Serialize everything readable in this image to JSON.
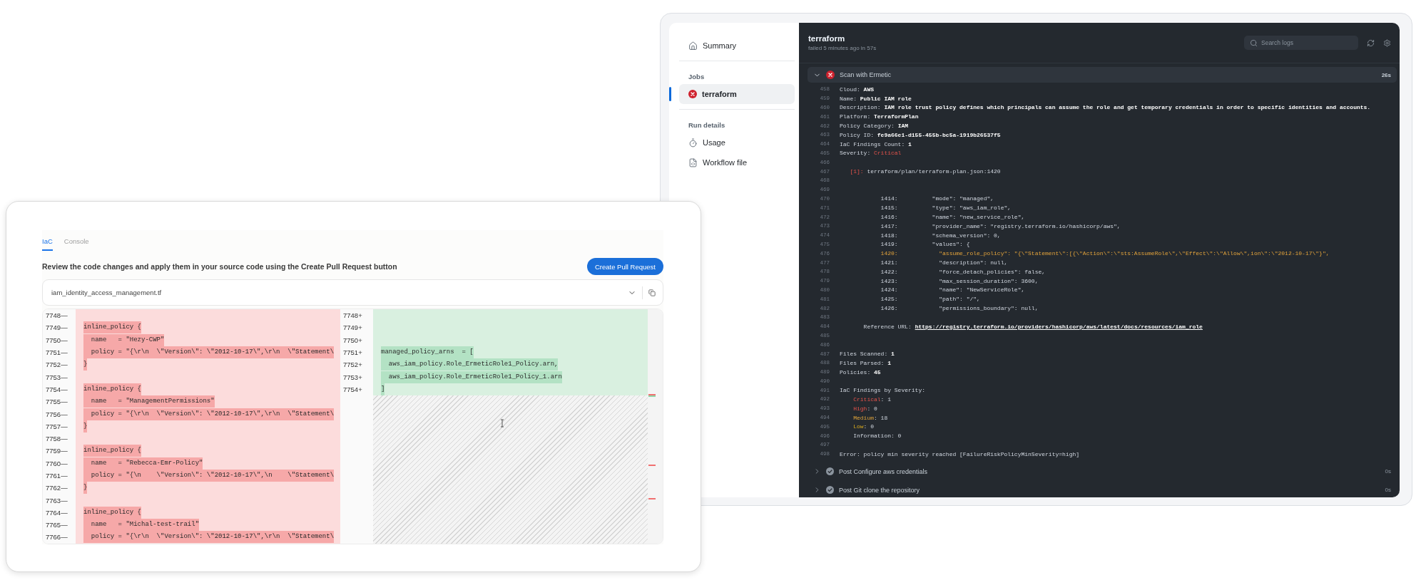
{
  "run_window": {
    "sidebar": {
      "nav": [
        {
          "label": "Summary",
          "kind": "home"
        }
      ],
      "jobs": {
        "heading": "Jobs",
        "items": [
          {
            "label": "terraform",
            "kind": "failed",
            "selected": true
          }
        ]
      },
      "run_details": {
        "heading": "Run details",
        "items": [
          {
            "label": "Usage",
            "kind": "timer"
          },
          {
            "label": "Workflow file",
            "kind": "file"
          }
        ]
      }
    },
    "job": {
      "title": "terraform",
      "subtitle": "failed 5 minutes ago in 57s",
      "search": {
        "placeholder": "Search logs"
      },
      "steps": [
        {
          "name": "Scan with Ermetic",
          "kind": "failed",
          "expanded": true,
          "duration": "26s",
          "log": [
            {
              "num": "458",
              "segments": [
                {
                  "text": "Cloud: ",
                  "kind": "plain"
                },
                {
                  "text": "AWS",
                  "kind": "bold"
                }
              ]
            },
            {
              "num": "459",
              "segments": [
                {
                  "text": "Name: ",
                  "kind": "plain"
                },
                {
                  "text": "Public IAM role",
                  "kind": "bold"
                }
              ]
            },
            {
              "num": "460",
              "segments": [
                {
                  "text": "Description: ",
                  "kind": "plain"
                },
                {
                  "text": "IAM role trust policy defines which principals can assume the role and get temporary credentials in order to specific identities and accounts.",
                  "kind": "bold"
                }
              ]
            },
            {
              "num": "461",
              "segments": [
                {
                  "text": "Platform: ",
                  "kind": "plain"
                },
                {
                  "text": "TerraformPlan",
                  "kind": "bold"
                }
              ]
            },
            {
              "num": "462",
              "segments": [
                {
                  "text": "Policy Category: ",
                  "kind": "plain"
                },
                {
                  "text": "IAM",
                  "kind": "bold"
                }
              ]
            },
            {
              "num": "463",
              "segments": [
                {
                  "text": "Policy ID: ",
                  "kind": "plain"
                },
                {
                  "text": "fe9a66e1-d155-455b-bc5a-1919b26537f5",
                  "kind": "bold"
                }
              ]
            },
            {
              "num": "464",
              "segments": [
                {
                  "text": "IaC Findings Count: ",
                  "kind": "plain"
                },
                {
                  "text": "1",
                  "kind": "bold"
                }
              ]
            },
            {
              "num": "465",
              "segments": [
                {
                  "text": "Severity: ",
                  "kind": "plain"
                },
                {
                  "text": "Critical",
                  "kind": "red"
                }
              ]
            },
            {
              "num": "466"
            },
            {
              "num": "467",
              "segments": [
                {
                  "text": "   [1]:",
                  "kind": "red"
                },
                {
                  "text": " terraform/plan/terraform-plan.json:1420",
                  "kind": "plain"
                }
              ]
            },
            {
              "num": "468"
            },
            {
              "num": "469"
            },
            {
              "num": "470",
              "segments": [
                {
                  "text": "            1414:          \"mode\": \"managed\",",
                  "kind": "plain"
                }
              ]
            },
            {
              "num": "471",
              "segments": [
                {
                  "text": "            1415:          \"type\": \"aws_iam_role\",",
                  "kind": "plain"
                }
              ]
            },
            {
              "num": "472",
              "segments": [
                {
                  "text": "            1416:          \"name\": \"new_service_role\",",
                  "kind": "plain"
                }
              ]
            },
            {
              "num": "473",
              "segments": [
                {
                  "text": "            1417:          \"provider_name\": \"registry.terraform.io/hashicorp/aws\",",
                  "kind": "plain"
                }
              ]
            },
            {
              "num": "474",
              "segments": [
                {
                  "text": "            1418:          \"schema_version\": 0,",
                  "kind": "plain"
                }
              ]
            },
            {
              "num": "475",
              "segments": [
                {
                  "text": "            1419:          \"values\": {",
                  "kind": "plain"
                }
              ]
            },
            {
              "num": "476",
              "segments": [
                {
                  "text": "            1420:            \"assume_role_policy\": \"{\\\"Statement\\\":[{\\\"Action\\\":\\\"sts:AssumeRole\\\",\\\"Effect\\\":\\\"Allow\\\",ion\\\":\\\"2012-10-17\\\"}\",",
                  "kind": "highlight"
                }
              ]
            },
            {
              "num": "477",
              "segments": [
                {
                  "text": "            1421:            \"description\": null,",
                  "kind": "plain"
                }
              ]
            },
            {
              "num": "478",
              "segments": [
                {
                  "text": "            1422:            \"force_detach_policies\": false,",
                  "kind": "plain"
                }
              ]
            },
            {
              "num": "479",
              "segments": [
                {
                  "text": "            1423:            \"max_session_duration\": 3600,",
                  "kind": "plain"
                }
              ]
            },
            {
              "num": "480",
              "segments": [
                {
                  "text": "            1424:            \"name\": \"NewServiceRole\",",
                  "kind": "plain"
                }
              ]
            },
            {
              "num": "481",
              "segments": [
                {
                  "text": "            1425:            \"path\": \"/\",",
                  "kind": "plain"
                }
              ]
            },
            {
              "num": "482",
              "segments": [
                {
                  "text": "            1426:            \"permissions_boundary\": null,",
                  "kind": "plain"
                }
              ]
            },
            {
              "num": "483"
            },
            {
              "num": "484",
              "segments": [
                {
                  "text": "       Reference URL: ",
                  "kind": "plain"
                },
                {
                  "text": "https://registry.terraform.io/providers/hashicorp/aws/latest/docs/resources/iam_role",
                  "kind": "link"
                }
              ]
            },
            {
              "num": "485"
            },
            {
              "num": "486"
            },
            {
              "num": "487",
              "segments": [
                {
                  "text": "Files Scanned: ",
                  "kind": "plain"
                },
                {
                  "text": "1",
                  "kind": "bold"
                }
              ]
            },
            {
              "num": "488",
              "segments": [
                {
                  "text": "Files Parsed: ",
                  "kind": "plain"
                },
                {
                  "text": "1",
                  "kind": "bold"
                }
              ]
            },
            {
              "num": "489",
              "segments": [
                {
                  "text": "Policies: ",
                  "kind": "plain"
                },
                {
                  "text": "45",
                  "kind": "bold"
                }
              ]
            },
            {
              "num": "490"
            },
            {
              "num": "491",
              "segments": [
                {
                  "text": "IaC Findings by Severity:",
                  "kind": "plain"
                }
              ]
            },
            {
              "num": "492",
              "segments": [
                {
                  "text": "    Critical",
                  "kind": "red"
                },
                {
                  "text": ": 1",
                  "kind": "plain"
                }
              ]
            },
            {
              "num": "493",
              "segments": [
                {
                  "text": "    High",
                  "kind": "red"
                },
                {
                  "text": ": 0",
                  "kind": "plain"
                }
              ]
            },
            {
              "num": "494",
              "segments": [
                {
                  "text": "    Medium",
                  "kind": "orange"
                },
                {
                  "text": ": 18",
                  "kind": "plain"
                }
              ]
            },
            {
              "num": "495",
              "segments": [
                {
                  "text": "    Low",
                  "kind": "yellow"
                },
                {
                  "text": ": 0",
                  "kind": "plain"
                }
              ]
            },
            {
              "num": "496",
              "segments": [
                {
                  "text": "    Information: 0",
                  "kind": "plain"
                }
              ]
            },
            {
              "num": "497"
            },
            {
              "num": "498",
              "segments": [
                {
                  "text": "Error: policy min severity reached [FailureRiskPolicyMinSeverity=high]",
                  "kind": "plain"
                }
              ]
            }
          ]
        },
        {
          "name": "Post Configure aws credentials",
          "kind": "success",
          "expanded": false,
          "duration": "0s"
        },
        {
          "name": "Post Git clone the repository",
          "kind": "success",
          "expanded": false,
          "duration": "0s"
        }
      ]
    }
  },
  "fix_window": {
    "tabs": [
      {
        "label": "IaC",
        "selected": true
      },
      {
        "label": "Console",
        "selected": false
      }
    ],
    "instructions": "Review the code changes and apply them in your source code using the Create Pull Request button",
    "create_button": "Create Pull Request",
    "file_select": {
      "value": "iam_identity_access_management.tf"
    },
    "diff": {
      "removed": [
        {
          "num": "7748",
          "marker": "—"
        },
        {
          "num": "7749",
          "marker": "—",
          "text": "inline_policy {"
        },
        {
          "num": "7750",
          "marker": "—",
          "text": "  name   = \"Hezy-CWP\""
        },
        {
          "num": "7751",
          "marker": "—",
          "text": "  policy = \"{\\r\\n  \\\"Version\\\": \\\"2012-10-17\\\",\\r\\n  \\\"Statement\\"
        },
        {
          "num": "7752",
          "marker": "—",
          "text": "}"
        },
        {
          "num": "7753",
          "marker": "—"
        },
        {
          "num": "7754",
          "marker": "—",
          "text": "inline_policy {"
        },
        {
          "num": "7755",
          "marker": "—",
          "text": "  name   = \"ManagementPermissions\""
        },
        {
          "num": "7756",
          "marker": "—",
          "text": "  policy = \"{\\r\\n  \\\"Version\\\": \\\"2012-10-17\\\",\\r\\n  \\\"Statement\\"
        },
        {
          "num": "7757",
          "marker": "—",
          "text": "}"
        },
        {
          "num": "7758",
          "marker": "—"
        },
        {
          "num": "7759",
          "marker": "—",
          "text": "inline_policy {"
        },
        {
          "num": "7760",
          "marker": "—",
          "text": "  name   = \"Rebecca-Emr-Policy\""
        },
        {
          "num": "7761",
          "marker": "—",
          "text": "  policy = \"{\\n    \\\"Version\\\": \\\"2012-10-17\\\",\\n    \\\"Statement\\"
        },
        {
          "num": "7762",
          "marker": "—",
          "text": "}"
        },
        {
          "num": "7763",
          "marker": "—"
        },
        {
          "num": "7764",
          "marker": "—",
          "text": "inline_policy {"
        },
        {
          "num": "7765",
          "marker": "—",
          "text": "  name   = \"Michal-test-trail\""
        },
        {
          "num": "7766",
          "marker": "—",
          "text": "  policy = \"{\\r\\n  \\\"Version\\\": \\\"2012-10-17\\\",\\r\\n  \\\"Statement\\"
        }
      ],
      "added": [
        {
          "num": "7748",
          "marker": "+"
        },
        {
          "num": "7749",
          "marker": "+"
        },
        {
          "num": "7750",
          "marker": "+"
        },
        {
          "num": "7751",
          "marker": "+",
          "text": "managed_policy_arns  = ["
        },
        {
          "num": "7752",
          "marker": "+",
          "text": "  aws_iam_policy.Role_ErmeticRole1_Policy.arn,"
        },
        {
          "num": "7753",
          "marker": "+",
          "text": "  aws_iam_policy.Role_ErmeticRole1_Policy_1.arn"
        },
        {
          "num": "7754",
          "marker": "+",
          "text": "]"
        }
      ]
    }
  }
}
